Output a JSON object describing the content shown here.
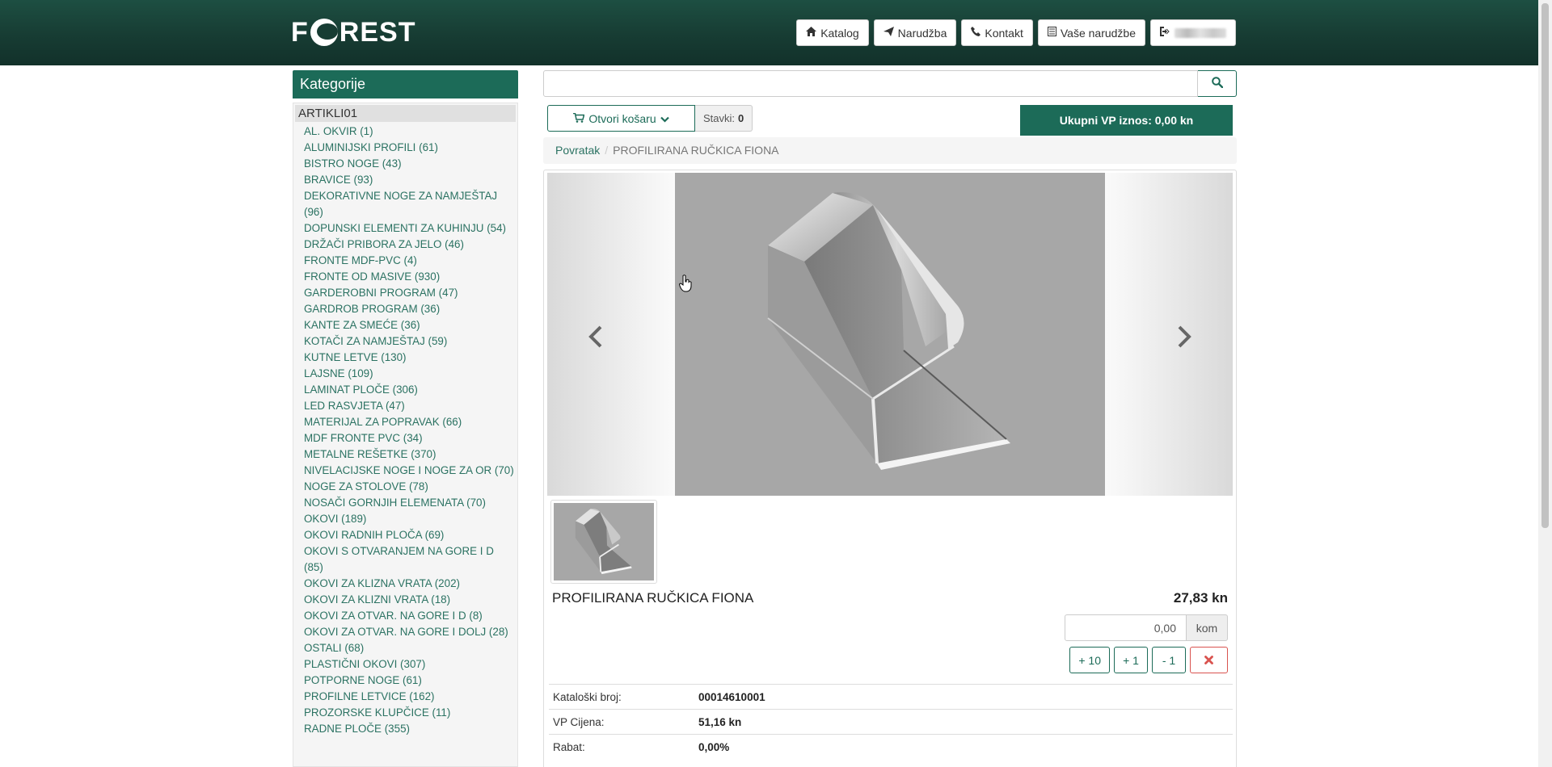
{
  "header": {
    "logo_text": "FOREST",
    "nav": [
      {
        "icon": "home-icon",
        "label": "Katalog"
      },
      {
        "icon": "send-icon",
        "label": "Narudžba"
      },
      {
        "icon": "phone-icon",
        "label": "Kontakt"
      },
      {
        "icon": "list-icon",
        "label": "Vaše narudžbe"
      },
      {
        "icon": "logout-icon",
        "label": ""
      }
    ]
  },
  "sidebar": {
    "title": "Kategorije",
    "root": "ARTIKLI01",
    "items": [
      "AL. OKVIR (1)",
      "ALUMINIJSKI PROFILI (61)",
      "BISTRO NOGE (43)",
      "BRAVICE (93)",
      "DEKORATIVNE NOGE ZA NAMJEŠTAJ (96)",
      "DOPUNSKI ELEMENTI ZA KUHINJU (54)",
      "DRŽAČI PRIBORA ZA JELO (46)",
      "FRONTE MDF-PVC (4)",
      "FRONTE OD MASIVE (930)",
      "GARDEROBNI PROGRAM (47)",
      "GARDROB PROGRAM (36)",
      "KANTE ZA SMEĆE (36)",
      "KOTAČI ZA NAMJEŠTAJ (59)",
      "KUTNE LETVE (130)",
      "LAJSNE (109)",
      "LAMINAT PLOČE (306)",
      "LED RASVJETA (47)",
      "MATERIJAL ZA POPRAVAK (66)",
      "MDF FRONTE PVC (34)",
      "METALNE REŠETKE (370)",
      "NIVELACIJSKE NOGE I NOGE ZA OR (70)",
      "NOGE ZA STOLOVE (78)",
      "NOSAČI GORNJIH ELEMENATA (70)",
      "OKOVI (189)",
      "OKOVI RADNIH PLOČA (69)",
      "OKOVI S OTVARANJEM NA GORE I D (85)",
      "OKOVI ZA KLIZNA VRATA (202)",
      "OKOVI ZA KLIZNI VRATA (18)",
      "OKOVI ZA OTVAR. NA GORE I D (8)",
      "OKOVI ZA OTVAR. NA GORE I DOLJ (28)",
      "OSTALI (68)",
      "PLASTIČNI OKOVI (307)",
      "POTPORNE NOGE (61)",
      "PROFILNE LETVICE (162)",
      "PROZORSKE KLUPČICE (11)",
      "RADNE PLOČE (355)"
    ]
  },
  "search": {
    "value": "",
    "placeholder": ""
  },
  "cart": {
    "open_label": "Otvori košaru",
    "items_label": "Stavki:",
    "items_count": "0",
    "total_label": "Ukupni VP iznos: 0,00 kn"
  },
  "breadcrumb": {
    "back": "Povratak",
    "current": "PROFILIRANA RUČKICA FIONA"
  },
  "product": {
    "title": "PROFILIRANA RUČKICA FIONA",
    "price": "27,83 kn",
    "quantity": "0,00",
    "unit": "kom",
    "steps": [
      "+ 10",
      "+ 1",
      "- 1"
    ],
    "details": [
      {
        "label": "Kataloški broj:",
        "value": "00014610001"
      },
      {
        "label": "VP Cijena:",
        "value": "51,16 kn"
      },
      {
        "label": "Rabat:",
        "value": "0,00%"
      }
    ]
  },
  "colors": {
    "brand": "#1c6b58",
    "header": "#173c33",
    "danger": "#d9534f"
  }
}
